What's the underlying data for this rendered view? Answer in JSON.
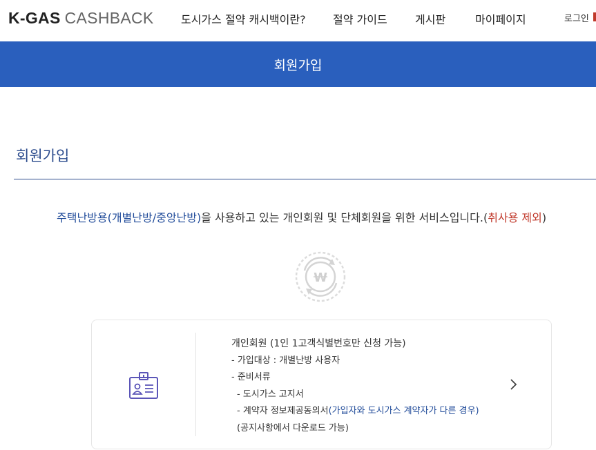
{
  "header": {
    "logo_strong": "K-GAS",
    "logo_light": "CASHBACK",
    "nav": [
      {
        "label": "도시가스 절약 캐시백이란?"
      },
      {
        "label": "절약 가이드"
      },
      {
        "label": "게시판"
      },
      {
        "label": "마이페이지"
      }
    ],
    "login": "로그인"
  },
  "banner": {
    "title": "회원가입"
  },
  "section": {
    "title": "회원가입"
  },
  "intro": {
    "part1": "주택난방용(개별난방/중앙난방)",
    "part2": "을 사용하고 있는 개인회원 및 단체회원을 위한 서비스입니다.(",
    "part3": "취사용 제외",
    "part4": ")"
  },
  "emblem": {
    "symbol": "W"
  },
  "card": {
    "title": "개인회원 (1인 1고객식별번호만 신청 가능)",
    "target": "- 가입대상 : 개별난방 사용자",
    "docs_label": "- 준비서류",
    "doc1": "- 도시가스 고지서",
    "doc2_main": "- 계약자 정보제공동의서",
    "doc2_note": "(가입자와 도시가스 계약자가 다른 경우)",
    "download_note": "(공지사항에서 다운로드 가능)",
    "icon": "id-card-icon"
  },
  "colors": {
    "brand_blue": "#2a5fbd",
    "text_blue": "#1f4a99",
    "accent_red": "#c0392b"
  }
}
